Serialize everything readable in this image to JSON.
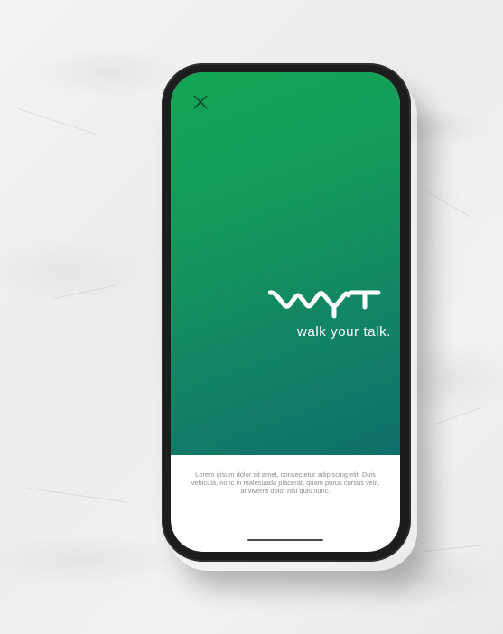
{
  "background": {
    "description_icon": "cracked-plaster-wall"
  },
  "device": {
    "frame_color": "#1d1d1d"
  },
  "screen": {
    "hero_gradient": [
      "#13a655",
      "#106e6a"
    ],
    "close_icon": "close-icon",
    "logo": {
      "icon": "wyt-logo-icon",
      "text": "WYT",
      "color": "#ffffff"
    },
    "tagline": "walk your talk.",
    "body_text": "Lorem ipsum dolor sit amet, consectetur adipiscing elit. Duis vehicula, nunc in malesuada placerat, quam purus cursus velit, at viverra dolor nisl quis nunc.",
    "home_indicator_icon": "home-indicator-bar"
  }
}
